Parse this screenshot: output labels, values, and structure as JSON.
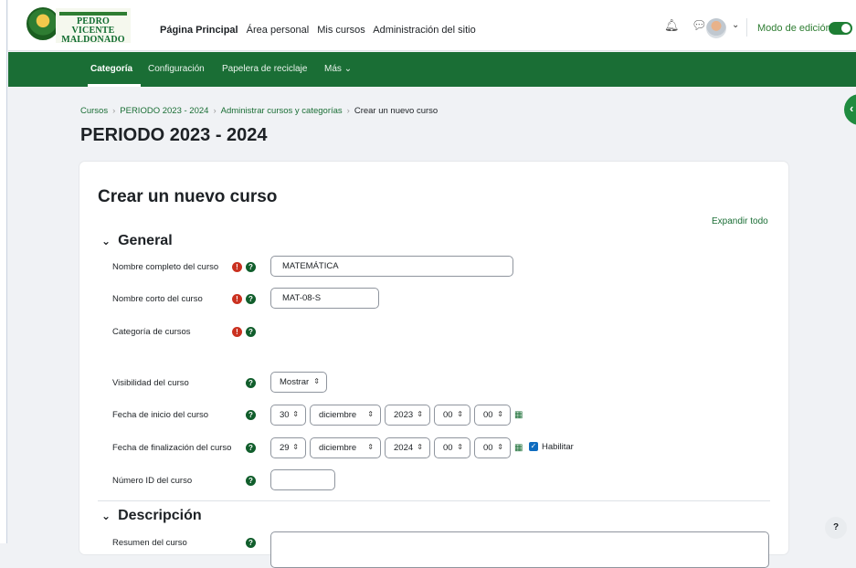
{
  "brand": {
    "name_line1": "PEDRO VICENTE",
    "name_line2": "MALDONADO"
  },
  "topnav": {
    "links": [
      "Página Principal",
      "Área personal",
      "Mis cursos",
      "Administración del sitio"
    ],
    "edit_mode_label": "Modo de edición",
    "edit_mode_on": true,
    "icons": [
      "bell-icon",
      "chat-icon",
      "avatar",
      "chevron-down-icon"
    ]
  },
  "secnav": {
    "items": [
      "Categoría",
      "Configuración",
      "Papelera de reciclaje",
      "Más"
    ],
    "active": "Categoría"
  },
  "breadcrumb": [
    "Cursos",
    "PERIODO 2023 - 2024",
    "Administrar cursos y categorías",
    "Crear un nuevo curso"
  ],
  "page_heading": "PERIODO 2023 - 2024",
  "form": {
    "title": "Crear un nuevo curso",
    "expand_all": "Expandir todo",
    "sections": {
      "general": "General",
      "description": "Descripción"
    },
    "fields": {
      "fullname": {
        "label": "Nombre completo del curso",
        "value": "MATEMÁTICA"
      },
      "shortname": {
        "label": "Nombre corto del curso",
        "value": "MAT-08-S"
      },
      "category": {
        "label": "Categoría de cursos"
      },
      "visibility": {
        "label": "Visibilidad del curso",
        "value": "Mostrar"
      },
      "startdate": {
        "label": "Fecha de inicio del curso",
        "day": "30",
        "month": "diciembre",
        "year": "2023",
        "hour": "00",
        "minute": "00"
      },
      "enddate": {
        "label": "Fecha de finalización del curso",
        "day": "29",
        "month": "diciembre",
        "year": "2024",
        "hour": "00",
        "minute": "00",
        "enable_label": "Habilitar",
        "enabled": true
      },
      "idnumber": {
        "label": "Número ID del curso",
        "value": ""
      },
      "summary": {
        "label": "Resumen del curso"
      }
    }
  },
  "colors": {
    "brand_green": "#1a6e35",
    "required": "#ca3120",
    "help": "#115e2c"
  },
  "help_button": "?"
}
